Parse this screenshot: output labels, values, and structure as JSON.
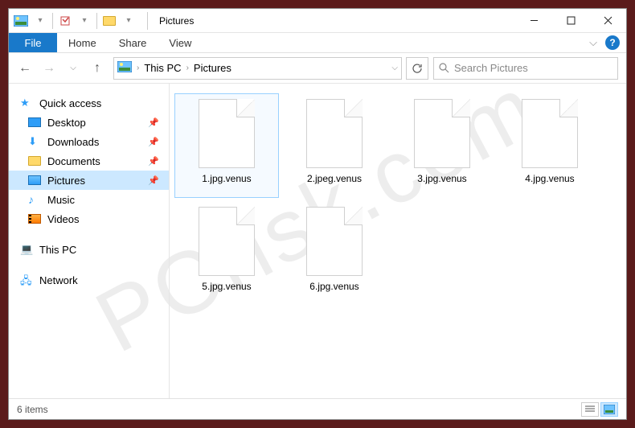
{
  "window": {
    "title": "Pictures"
  },
  "ribbon": {
    "file": "File",
    "tabs": [
      "Home",
      "Share",
      "View"
    ]
  },
  "nav": {
    "breadcrumbs": [
      "This PC",
      "Pictures"
    ],
    "search_placeholder": "Search Pictures"
  },
  "sidebar": {
    "quick_access": "Quick access",
    "items": [
      {
        "label": "Desktop",
        "pinned": true
      },
      {
        "label": "Downloads",
        "pinned": true
      },
      {
        "label": "Documents",
        "pinned": true
      },
      {
        "label": "Pictures",
        "pinned": true,
        "selected": true
      },
      {
        "label": "Music",
        "pinned": false
      },
      {
        "label": "Videos",
        "pinned": false
      }
    ],
    "this_pc": "This PC",
    "network": "Network"
  },
  "files": [
    {
      "name": "1.jpg.venus",
      "selected": true
    },
    {
      "name": "2.jpeg.venus"
    },
    {
      "name": "3.jpg.venus"
    },
    {
      "name": "4.jpg.venus"
    },
    {
      "name": "5.jpg.venus"
    },
    {
      "name": "6.jpg.venus"
    }
  ],
  "status": {
    "count_label": "6 items"
  }
}
